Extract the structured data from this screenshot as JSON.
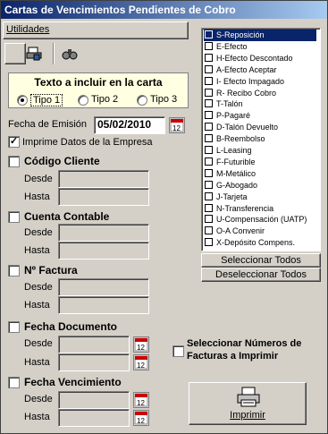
{
  "window": {
    "title": "Cartas de Vencimientos Pendientes de Cobro"
  },
  "menu": {
    "utilidades": "Utilidades"
  },
  "toolbar": {
    "icons": [
      "printer-settings-icon",
      "binoculars-icon"
    ]
  },
  "carta": {
    "title": "Texto a incluir en la carta",
    "options": [
      "Tipo 1",
      "Tipo 2",
      "Tipo 3"
    ],
    "selected": "Tipo 1"
  },
  "emision": {
    "label": "Fecha de Emisión",
    "value": "05/02/2010"
  },
  "imprime": {
    "label": "Imprime Datos de la Empresa",
    "checked": true
  },
  "sections": {
    "codigo": {
      "label": "Código Cliente",
      "desde": "Desde",
      "hasta": "Hasta"
    },
    "cuenta": {
      "label": "Cuenta Contable",
      "desde": "Desde",
      "hasta": "Hasta"
    },
    "factura": {
      "label": "Nº Factura",
      "desde": "Desde",
      "hasta": "Hasta"
    },
    "fechadoc": {
      "label": "Fecha Documento",
      "desde": "Desde",
      "hasta": "Hasta"
    },
    "fechavenc": {
      "label": "Fecha Vencimiento",
      "desde": "Desde",
      "hasta": "Hasta"
    }
  },
  "tipos": [
    "S-Reposición",
    "E-Efecto",
    "H-Efecto Descontado",
    "A-Efecto Aceptar",
    "I- Efecto Impagado",
    "R- Recibo Cobro",
    "T-Talón",
    "P-Pagaré",
    "D-Talón Devuelto",
    "B-Reembolso",
    "L-Leasing",
    "F-Futurible",
    "M-Metálico",
    "G-Abogado",
    "J-Tarjeta",
    "N-Transferencia",
    "U-Compensación (UATP)",
    "O-A Convenir",
    "X-Depósito Compens."
  ],
  "buttons": {
    "seleccionar": "Seleccionar Todos",
    "deseleccionar": "Deseleccionar Todos",
    "imprimir": "Imprimir"
  },
  "seleccionar_facturas": {
    "line1": "Seleccionar Números de",
    "line2": "Facturas a Imprimir"
  }
}
